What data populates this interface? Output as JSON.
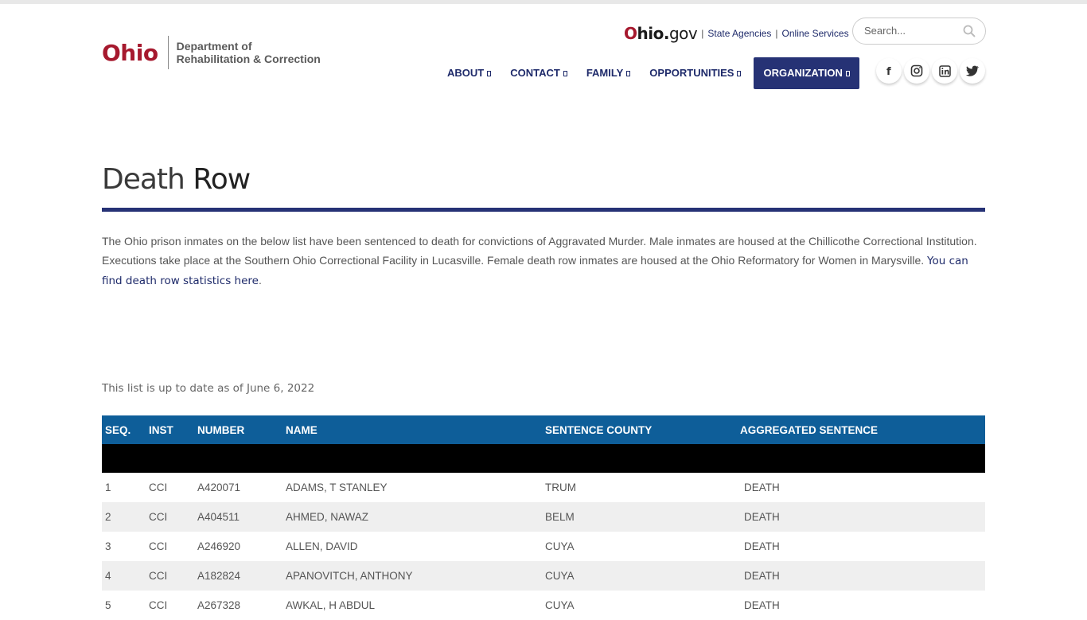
{
  "logo": {
    "ohio": "Ohio",
    "line1": "Department of",
    "line2": "Rehabilitation & Correction"
  },
  "utility": {
    "ohiogov_o": "O",
    "ohiogov_hio": "hio.",
    "ohiogov_gov": "gov",
    "links": [
      "State Agencies",
      "Online Services"
    ],
    "separator": "|"
  },
  "search": {
    "placeholder": "Search..."
  },
  "nav": {
    "items": [
      "ABOUT",
      "CONTACT",
      "FAMILY",
      "OPPORTUNITIES",
      "ORGANIZATION"
    ],
    "active": "ORGANIZATION"
  },
  "social": [
    "f",
    "ig",
    "in",
    "tw"
  ],
  "page": {
    "title_light": "Death",
    "title_bold": "Row",
    "intro": "The Ohio prison inmates on the below list have been sentenced to death for convictions of Aggravated Murder. Male inmates are housed at the Chillicothe Correctional Institution. Executions take place at the Southern Ohio Correctional Facility in Lucasville. Female death row inmates are housed at the Ohio Reformatory for Women in Marysville. ",
    "intro_link": "You can find death row statistics here",
    "intro_end": ".",
    "updated": "This list is up to date as of June 6, 2022"
  },
  "table": {
    "headers": [
      "SEQ.",
      "INST",
      "NUMBER",
      "NAME",
      "SENTENCE COUNTY",
      "AGGREGATED SENTENCE"
    ],
    "rows": [
      [
        "1",
        "CCI",
        "A420071",
        "ADAMS, T STANLEY",
        "TRUM",
        "DEATH"
      ],
      [
        "2",
        "CCI",
        "A404511",
        "AHMED, NAWAZ",
        "BELM",
        "DEATH"
      ],
      [
        "3",
        "CCI",
        "A246920",
        "ALLEN, DAVID",
        "CUYA",
        "DEATH"
      ],
      [
        "4",
        "CCI",
        "A182824",
        "APANOVITCH, ANTHONY",
        "CUYA",
        "DEATH"
      ],
      [
        "5",
        "CCI",
        "A267328",
        "AWKAL, H ABDUL",
        "CUYA",
        "DEATH"
      ]
    ]
  },
  "colors": {
    "brand_red": "#a6192e",
    "navy": "#263275",
    "table_header": "#0e5e99"
  }
}
